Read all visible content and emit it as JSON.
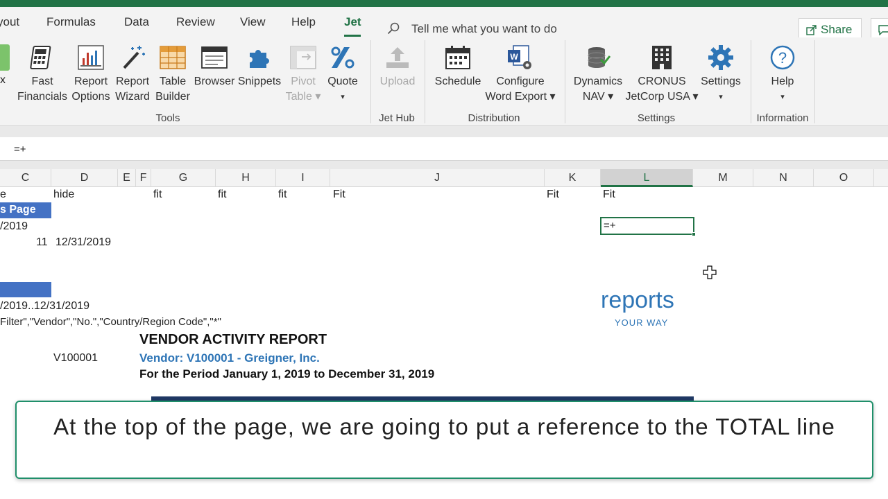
{
  "tabs": {
    "items": [
      {
        "label": "yout",
        "left": 0
      },
      {
        "label": "Formulas"
      },
      {
        "label": "Data"
      },
      {
        "label": "Review"
      },
      {
        "label": "View"
      },
      {
        "label": "Help"
      },
      {
        "label": "Jet"
      }
    ],
    "active": "Jet",
    "tell_me": "Tell me what you want to do",
    "share": "Share"
  },
  "ribbon": {
    "tools": {
      "group_label": "Tools",
      "buttons": [
        {
          "l1": "Fast",
          "l2": "Financials"
        },
        {
          "l1": "Report",
          "l2": "Options"
        },
        {
          "l1": "Report",
          "l2": "Wizard"
        },
        {
          "l1": "Table",
          "l2": "Builder"
        },
        {
          "l1": "Browser",
          "l2": ""
        },
        {
          "l1": "Snippets",
          "l2": ""
        },
        {
          "l1": "Pivot",
          "l2": "Table ▾"
        },
        {
          "l1": "Quote",
          "l2": "▾"
        }
      ],
      "partial": "x"
    },
    "jethub": {
      "group_label": "Jet Hub",
      "upload": "Upload"
    },
    "distribution": {
      "group_label": "Distribution",
      "schedule": "Schedule",
      "configure_l1": "Configure",
      "configure_l2": "Word Export ▾"
    },
    "settings": {
      "group_label": "Settings",
      "dynamics_l1": "Dynamics",
      "dynamics_l2": "NAV ▾",
      "cronus_l1": "CRONUS",
      "cronus_l2": "JetCorp USA ▾",
      "settings_l1": "Settings",
      "settings_l2": "▾"
    },
    "information": {
      "group_label": "Information",
      "help_l1": "Help",
      "help_l2": "▾"
    }
  },
  "formula_bar": {
    "value": "=+"
  },
  "columns": [
    "C",
    "D",
    "E",
    "F",
    "G",
    "H",
    "I",
    "J",
    "K",
    "L",
    "M",
    "N",
    "O"
  ],
  "selected_column": "L",
  "grid": {
    "row1": {
      "c": "e",
      "d": "hide",
      "g": "fit",
      "h": "fit",
      "i": "fit",
      "j": "Fit",
      "k": "Fit",
      "l": "Fit"
    },
    "row2_bar": "s Page",
    "row3": "/2019",
    "row4_num": "11",
    "row4_date": "12/31/2019",
    "row6": "/2019..12/31/2019",
    "row7": "Filter\",\"Vendor\",\"No.\",\"Country/Region Code\",\"*\"",
    "vendor_code": "V100001",
    "active_cell": "=+"
  },
  "logo": {
    "main": "reports",
    "sub": "YOUR WAY"
  },
  "report": {
    "title": "VENDOR ACTIVITY REPORT",
    "vendor": "Vendor: V100001 - Greigner, Inc.",
    "period": "For the Period January 1, 2019 to December 31, 2019"
  },
  "caption": "At the top of the page, we are going to put a reference to the TOTAL line",
  "colors": {
    "excel_green": "#217346",
    "jet_blue": "#2e75b6",
    "header_blue": "#4472c4",
    "navy": "#1f3864"
  }
}
